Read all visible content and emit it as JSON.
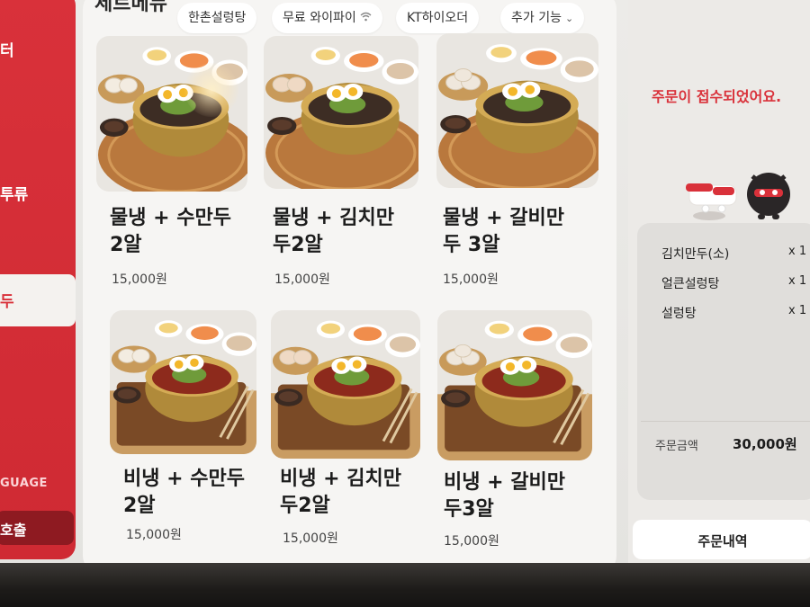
{
  "sidebar": {
    "items": [
      {
        "label": "터"
      },
      {
        "label": "투류"
      }
    ],
    "active_label": "두",
    "language_label": "GUAGE",
    "call_label": "호출"
  },
  "header": {
    "category_title": "세트메뉴",
    "chips": [
      {
        "label": "한촌설렁탕"
      },
      {
        "label": "무료 와이파이",
        "icon": "wifi-icon"
      },
      {
        "label": "KT하이오더"
      },
      {
        "label": "추가 기능",
        "icon": "chevron-down-icon"
      }
    ]
  },
  "menu": {
    "items": [
      {
        "name": "물냉 + 수만두\n2알",
        "price": "15,000원",
        "dish": "mulnaengmyeon",
        "side": "steamed-dumplings"
      },
      {
        "name": "물냉 + 김치만\n두2알",
        "price": "15,000원",
        "dish": "mulnaengmyeon",
        "side": "kimchi-dumplings"
      },
      {
        "name": "물냉 + 갈비만\n두 3알",
        "price": "15,000원",
        "dish": "mulnaengmyeon",
        "side": "galbi-dumplings"
      },
      {
        "name": "비냉 + 수만두\n2알",
        "price": "15,000원",
        "dish": "bibimnaengmyeon",
        "side": "steamed-dumplings"
      },
      {
        "name": "비냉 + 김치만\n두2알",
        "price": "15,000원",
        "dish": "bibimnaengmyeon",
        "side": "kimchi-dumplings"
      },
      {
        "name": "비냉 + 갈비만\n두3알",
        "price": "15,000원",
        "dish": "bibimnaengmyeon",
        "side": "galbi-dumplings"
      }
    ]
  },
  "cart": {
    "message": "주문이 접수되었어요.",
    "items": [
      {
        "name": "김치만두(소)",
        "qty": "x 1"
      },
      {
        "name": "얼큰설렁탕",
        "qty": "x 1"
      },
      {
        "name": "설렁탕",
        "qty": "x 1"
      }
    ],
    "total_label": "주문금액",
    "total_value": "30,000원",
    "history_button": "주문내역"
  },
  "colors": {
    "accent": "#d9313a",
    "sidebar": "#cf2a33",
    "panel": "#f6f5f3",
    "cart_box": "#e0dedb"
  }
}
